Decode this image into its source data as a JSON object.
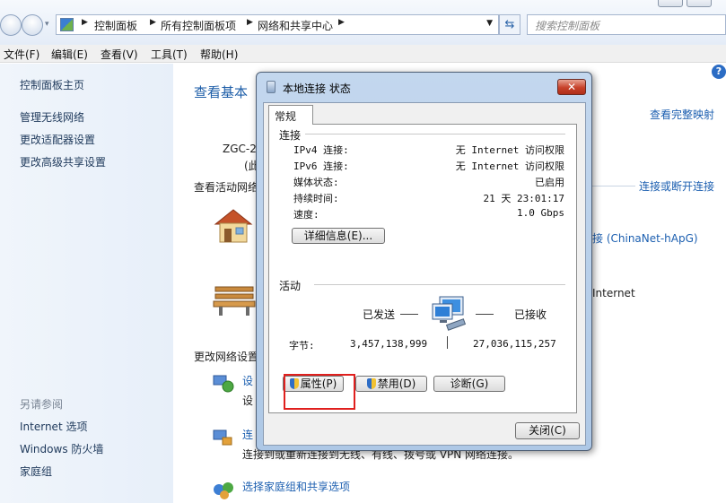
{
  "address_bar": {
    "crumbs": [
      "控制面板",
      "所有控制面板项",
      "网络和共享中心"
    ],
    "search_placeholder": "搜索控制面板"
  },
  "menu": [
    "文件(F)",
    "编辑(E)",
    "查看(V)",
    "工具(T)",
    "帮助(H)"
  ],
  "left_pane": {
    "home": "控制面板主页",
    "links": [
      "管理无线网络",
      "更改适配器设置",
      "更改高级共享设置"
    ],
    "see_also_title": "另请参阅",
    "see_also": [
      "Internet 选项",
      "Windows 防火墙",
      "家庭组"
    ]
  },
  "main": {
    "title": "查看基本",
    "computer_name": "ZGC-2",
    "computer_sub": "(此",
    "active_networks": "查看活动网络",
    "full_map_link": "查看完整映射",
    "connect_link": "连接或断开连接",
    "network_link": "接 (ChinaNet-hApG)",
    "internet_text": "Internet",
    "change_settings": "更改网络设置",
    "task1_link": "设",
    "task1_sub": "设",
    "task2_link": "连",
    "task2_sub": "连接到或重新连接到无线、有线、拨号或 VPN 网络连接。",
    "task3_link": "选择家庭组和共享选项"
  },
  "dialog": {
    "title": "本地连接 状态",
    "tab": "常规",
    "connection_head": "连接",
    "rows": [
      {
        "label": "IPv4 连接:",
        "value": "无 Internet 访问权限"
      },
      {
        "label": "IPv6 连接:",
        "value": "无 Internet 访问权限"
      },
      {
        "label": "媒体状态:",
        "value": "已启用"
      },
      {
        "label": "持续时间:",
        "value": "21 天 23:01:17"
      },
      {
        "label": "速度:",
        "value": "1.0 Gbps"
      }
    ],
    "details_button": "详细信息(E)...",
    "activity_head": "活动",
    "sent_label": "已发送",
    "received_label": "已接收",
    "bytes_label": "字节:",
    "bytes_sent": "3,457,138,999",
    "bytes_received": "27,036,115,257",
    "properties_button": "属性(P)",
    "disable_button": "禁用(D)",
    "diagnose_button": "诊断(G)",
    "close_button": "关闭(C)"
  }
}
